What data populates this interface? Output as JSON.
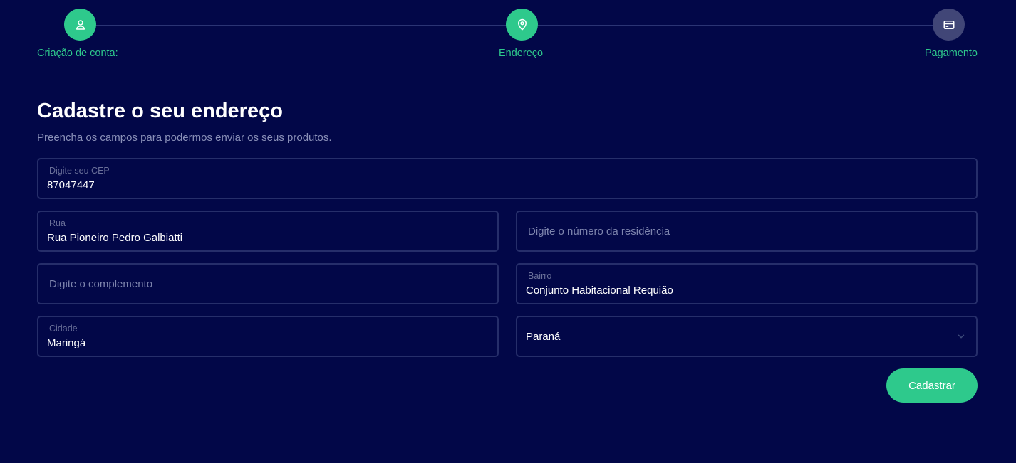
{
  "colors": {
    "background": "#020748",
    "accent": "#2ec98c",
    "step_inactive": "#414677"
  },
  "stepper": {
    "steps": [
      {
        "label": "Criação de conta:",
        "icon": "user-icon",
        "active": true
      },
      {
        "label": "Endereço",
        "icon": "map-pin-icon",
        "active": true
      },
      {
        "label": "Pagamento",
        "icon": "credit-card-icon",
        "active": false
      }
    ]
  },
  "page": {
    "title": "Cadastre o seu endereço",
    "subtitle": "Preencha os campos para podermos enviar os seus produtos."
  },
  "form": {
    "cep": {
      "label": "Digite seu CEP",
      "value": "87047447"
    },
    "rua": {
      "label": "Rua",
      "value": "Rua Pioneiro Pedro Galbiatti"
    },
    "numero": {
      "placeholder": "Digite o número da residência"
    },
    "complemento": {
      "placeholder": "Digite o complemento"
    },
    "bairro": {
      "label": "Bairro",
      "value": "Conjunto Habitacional Requião"
    },
    "cidade": {
      "label": "Cidade",
      "value": "Maringá"
    },
    "estado": {
      "value": "Paraná",
      "icon": "chevron-down-icon"
    },
    "submit_label": "Cadastrar"
  }
}
